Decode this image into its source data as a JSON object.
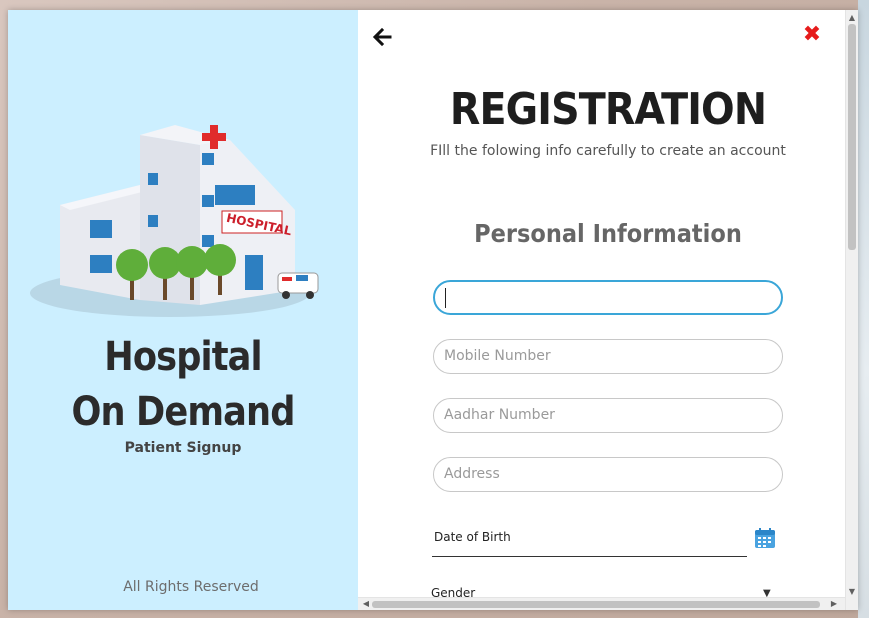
{
  "brand": {
    "line1": "Hospital",
    "line2": "On Demand",
    "subtitle": "Patient Signup",
    "footer": "All Rights Reserved",
    "panel_color": "#ccefff"
  },
  "header": {
    "back_icon": "arrow-left-icon",
    "close_icon": "close-x-icon",
    "close_color": "#e61b1b"
  },
  "form": {
    "title": "REGISTRATION",
    "subtitle": "FIll the folowing info carefully to create an account",
    "section": "Personal Information",
    "fields": [
      {
        "name": "name",
        "value": "",
        "placeholder": "",
        "focused": true
      },
      {
        "name": "mobile",
        "value": "",
        "placeholder": "Mobile Number"
      },
      {
        "name": "aadhar",
        "value": "",
        "placeholder": "Aadhar Number"
      },
      {
        "name": "address",
        "value": "",
        "placeholder": "Address"
      }
    ],
    "dob_label": "Date of Birth",
    "calendar_icon": "calendar-icon",
    "gender_label": "Gender",
    "accent_color": "#3aa6d8"
  }
}
